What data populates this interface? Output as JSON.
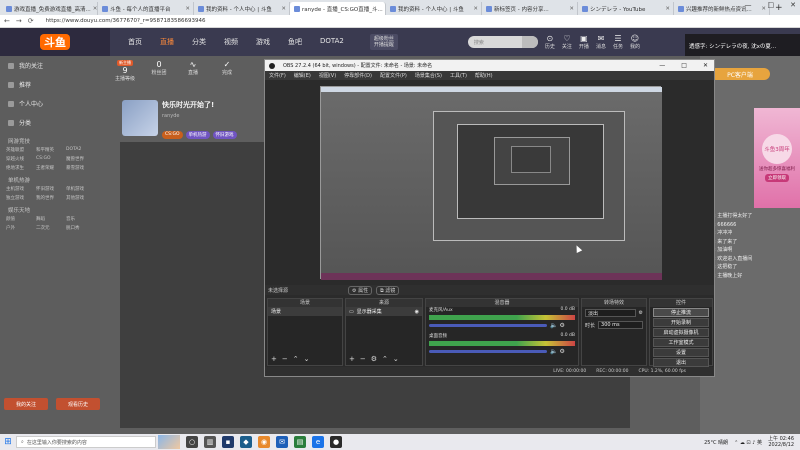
{
  "browser": {
    "tabs": [
      {
        "title": "游戏直播_免费游戏直播_高清..."
      },
      {
        "title": "斗鱼 - 每个人的直播平台"
      },
      {
        "title": "我的资料 - 个人中心 | 斗鱼"
      },
      {
        "title": "ranyde - 直播_CS:GO直播_斗..."
      },
      {
        "title": "我的资料 - 个人中心 | 斗鱼"
      },
      {
        "title": "新标签页 - 内容分享..."
      },
      {
        "title": "シンデレラ - YouTube"
      },
      {
        "title": "兴趣推荐的新鲜热点资讯..."
      }
    ],
    "new_tab": "+",
    "window_controls": [
      "—",
      "□",
      "✕"
    ],
    "nav": {
      "back": "←",
      "forward": "→",
      "reload": "⟳"
    },
    "url": "https://www.douyu.com/3677670?_r=9587183586693946"
  },
  "site": {
    "logo": "斗鱼",
    "nav": [
      "首页",
      "直播",
      "分类",
      "视频",
      "游戏",
      "鱼吧",
      "DOTA2"
    ],
    "active_nav": "直播",
    "subscribe_top": "超级粉丝",
    "subscribe_bottom": "开播提醒",
    "search_placeholder": "搜索",
    "header_icons": [
      {
        "glyph": "⊙",
        "label": "历史"
      },
      {
        "glyph": "♡",
        "label": "关注"
      },
      {
        "glyph": "▣",
        "label": "开播"
      },
      {
        "glyph": "✉",
        "label": "消息"
      },
      {
        "glyph": "☰",
        "label": "任务"
      },
      {
        "glyph": "☺",
        "label": "我的"
      }
    ],
    "banner_ad": "透感字: シンデレラの夜, 沈xの夏..."
  },
  "sidebar": {
    "items": [
      {
        "label": "我的关注"
      },
      {
        "label": "推荐"
      },
      {
        "label": "个人中心"
      },
      {
        "label": "分类"
      }
    ],
    "sections": [
      {
        "title": "网游竞技",
        "links": [
          "英雄联盟",
          "和平精英",
          "DOTA2",
          "穿越火线",
          "CS:GO",
          "魔兽世界",
          "绝地求生",
          "王者荣耀",
          "暴雪游戏"
        ]
      },
      {
        "title": "单机热游",
        "links": [
          "主机游戏",
          "怀旧游戏",
          "单机游戏",
          "独立游戏",
          "我的世界",
          "其他游戏"
        ]
      },
      {
        "title": "娱乐天地",
        "links": [
          "颜值",
          "舞蹈",
          "音乐",
          "户外",
          "二次元",
          "脱口秀"
        ]
      }
    ],
    "buttons": [
      "我的关注",
      "观看历史"
    ]
  },
  "room": {
    "stats": [
      {
        "n": "9",
        "label": "主播等级",
        "badge": "新主播"
      },
      {
        "n": "0",
        "label": "粉丝团",
        "badge": ""
      },
      {
        "n": "∿",
        "label": "直播",
        "badge": ""
      },
      {
        "n": "✓",
        "label": "完成",
        "badge": ""
      }
    ],
    "title": "快乐时光开始了!",
    "streamer_name": "ranyde",
    "tags": [
      {
        "text": "CS:GO"
      },
      {
        "text": "单机热游"
      },
      {
        "text": "怀旧游戏"
      }
    ]
  },
  "right": {
    "pc_button": "PC客户端",
    "ad_title": "斗鱼3周年",
    "ad_sub": "送你超多惊喜福利",
    "ad_btn": "立即领取",
    "text_lines": [
      "水友: 主播打得太好了",
      "弹幕: 666666",
      "弹幕: 冲冲冲",
      "水友: 来了来了",
      "弹幕: 加油啊",
      "系统: 欢迎进入直播间",
      "弹幕: 这把稳了",
      "水友: 主播晚上好"
    ]
  },
  "obs": {
    "title": "OBS 27.2.4 (64 bit, windows) - 配置文件: 未命名 - 场景: 未命名",
    "menu": [
      "文件(F)",
      "编辑(E)",
      "视图(V)",
      "停靠部件(D)",
      "配置文件(P)",
      "场景集合(S)",
      "工具(T)",
      "帮助(H)"
    ],
    "no_source": "未选择源",
    "props_btn": "⚙ 属性",
    "filter_btn": "⧉ 滤镜",
    "docks": {
      "scenes": {
        "title": "场景",
        "items": [
          "场景"
        ]
      },
      "sources": {
        "title": "来源",
        "items": [
          "显示器采集"
        ]
      },
      "mixer": {
        "title": "混音器",
        "tracks": [
          {
            "name": "麦克风/Aux",
            "db": "0.0 dB"
          },
          {
            "name": "桌面音频",
            "db": "0.0 dB"
          }
        ]
      },
      "transitions": {
        "title": "转场特效",
        "type": "淡出",
        "duration_label": "时长",
        "duration": "300 ms"
      },
      "controls": {
        "title": "控件",
        "buttons": [
          "停止推流",
          "开始录制",
          "启动虚拟摄像机",
          "工作室模式",
          "设置",
          "退出"
        ]
      }
    },
    "status": [
      "LIVE: 00:00:00",
      "REC: 00:00:00",
      "CPU: 1.2%, 60.00 fps"
    ]
  },
  "taskbar": {
    "start": "⊞",
    "search": "在这里输入你要搜索的内容",
    "apps": [
      {
        "glyph": "○",
        "color": "#444444"
      },
      {
        "glyph": "▥",
        "color": "#555555"
      },
      {
        "glyph": "▪",
        "color": "#1f3a6b"
      },
      {
        "glyph": "◆",
        "color": "#1b5e8c"
      },
      {
        "glyph": "◉",
        "color": "#e8892b"
      },
      {
        "glyph": "✉",
        "color": "#1d5fb8"
      },
      {
        "glyph": "▤",
        "color": "#2a7d3c"
      },
      {
        "glyph": "e",
        "color": "#1a73e8"
      },
      {
        "glyph": "●",
        "color": "#2a2a2a"
      }
    ],
    "weather": "25°C 晴朗",
    "tray_icons": "⌃ ☁ ⊡ ♪ 英",
    "time": "上午 02:46",
    "date": "2022/8/12"
  }
}
